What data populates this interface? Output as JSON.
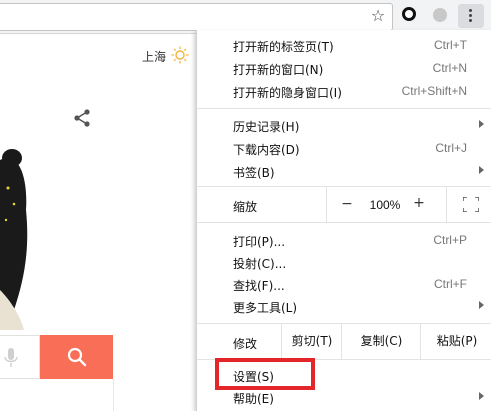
{
  "weather": {
    "city": "上海"
  },
  "menu": {
    "items": [
      {
        "label": "打开新的标签页(T)",
        "shortcut": "Ctrl+T"
      },
      {
        "label": "打开新的窗口(N)",
        "shortcut": "Ctrl+N"
      },
      {
        "label": "打开新的隐身窗口(I)",
        "shortcut": "Ctrl+Shift+N"
      },
      {
        "label": "历史记录(H)",
        "shortcut": ""
      },
      {
        "label": "下载内容(D)",
        "shortcut": "Ctrl+J"
      },
      {
        "label": "书签(B)",
        "shortcut": ""
      },
      {
        "label": "打印(P)...",
        "shortcut": "Ctrl+P"
      },
      {
        "label": "投射(C)...",
        "shortcut": ""
      },
      {
        "label": "查找(F)...",
        "shortcut": "Ctrl+F"
      },
      {
        "label": "更多工具(L)",
        "shortcut": ""
      },
      {
        "label": "设置(S)",
        "shortcut": ""
      },
      {
        "label": "帮助(E)",
        "shortcut": ""
      }
    ],
    "zoom": {
      "label": "缩放",
      "minus": "−",
      "level": "100%",
      "plus": "+"
    },
    "edit": {
      "label": "修改",
      "cut": "剪切(T)",
      "copy": "复制(C)",
      "paste": "粘贴(P)"
    }
  },
  "colors": {
    "search_button": "#f86e56",
    "highlight": "#e3262a"
  }
}
